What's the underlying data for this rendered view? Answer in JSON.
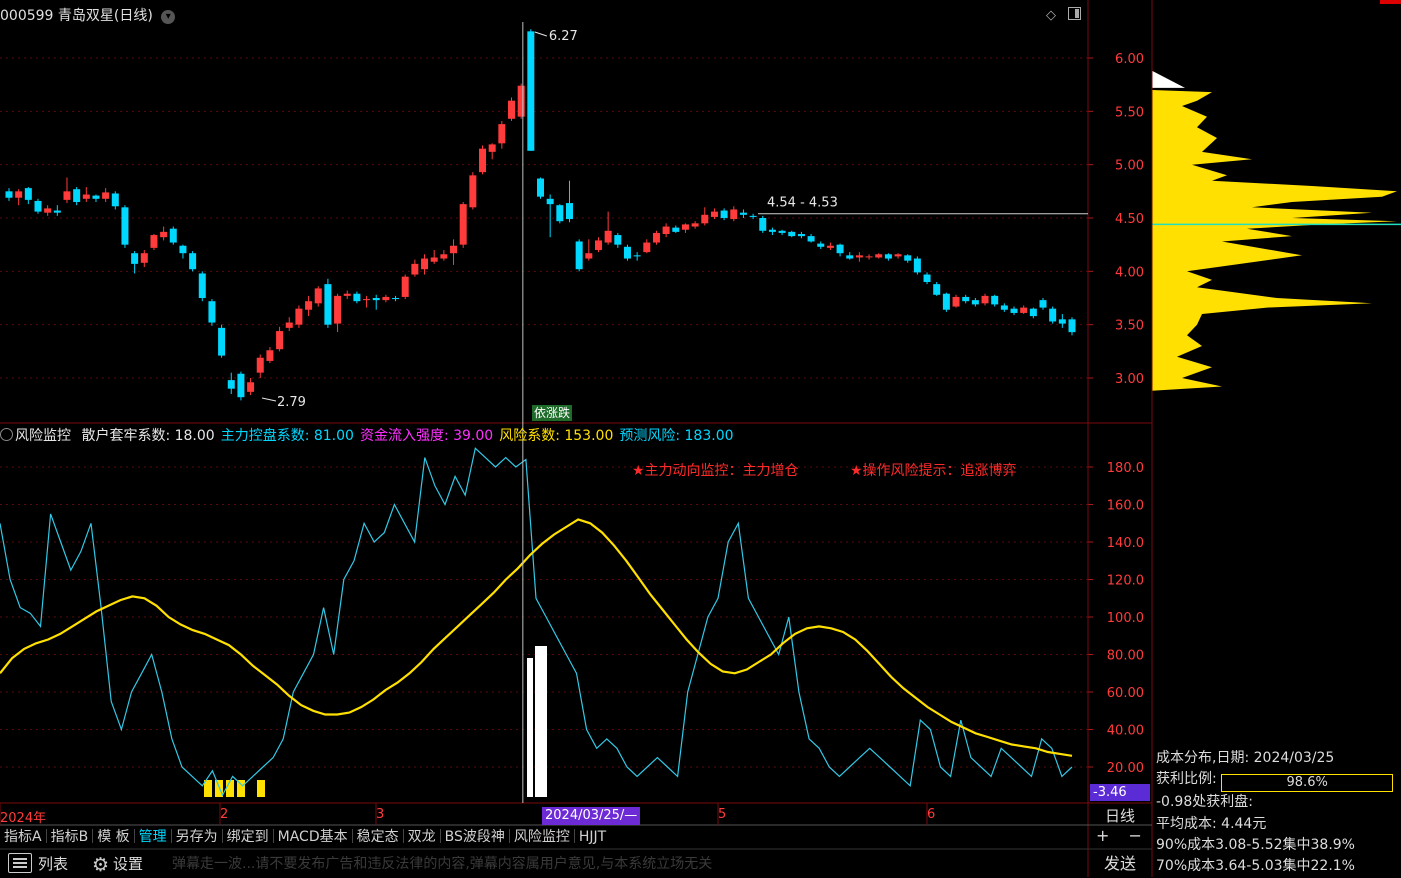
{
  "header": {
    "stock_code": "000599",
    "stock_name": "青岛双星",
    "period": "(日线)",
    "icon_chevron": "chevron-down-icon",
    "icon_diamond": "diamond-icon",
    "icon_panel": "panel-toggle-icon"
  },
  "price_axis": {
    "labels": [
      "6.00",
      "5.50",
      "5.00",
      "4.50",
      "4.00",
      "3.50",
      "3.00"
    ],
    "values": [
      6.0,
      5.5,
      5.0,
      4.5,
      4.0,
      3.5,
      3.0
    ],
    "color": "#ff3b3b"
  },
  "annotations": {
    "high_label": "6.27",
    "low_label": "2.79",
    "range_label": "4.54 - 4.53",
    "signal_tag": "依涨跌"
  },
  "indicator": {
    "name": "风险监控",
    "params": [
      {
        "label": "散户套牢系数:",
        "value": "18.00",
        "color": "#e6e6e6"
      },
      {
        "label": "主力控盘系数:",
        "value": "81.00",
        "color": "#00d8ff"
      },
      {
        "label": "资金流入强度:",
        "value": "39.00",
        "color": "#ff30ff"
      },
      {
        "label": "风险系数:",
        "value": "153.00",
        "color": "#ffe000"
      },
      {
        "label": "预测风险:",
        "value": "183.00",
        "color": "#00d8ff"
      }
    ],
    "hint1": "★主力动向监控：主力增仓",
    "hint2": "★操作风险提示：追涨博弈",
    "axis_labels": [
      "180.0",
      "160.0",
      "140.0",
      "120.0",
      "100.0",
      "80.00",
      "60.00",
      "40.00",
      "20.00"
    ],
    "axis_values": [
      180,
      160,
      140,
      120,
      100,
      80,
      60,
      40,
      20
    ],
    "current_value": "-3.46"
  },
  "time_axis": {
    "labels": [
      {
        "text": "2024年",
        "pos": 0
      },
      {
        "text": "2",
        "pos": 220
      },
      {
        "text": "3",
        "pos": 376
      },
      {
        "text": "5",
        "pos": 718
      },
      {
        "text": "6",
        "pos": 927
      }
    ],
    "cursor_date": "2024/03/25/—"
  },
  "period_label": "日线",
  "tabs": [
    "指标A",
    "指标B",
    "模 板",
    "管理",
    "另存为",
    "绑定到",
    "MACD基本",
    "稳定态",
    "双龙",
    "BS波段神",
    "风险监控",
    "HJJT"
  ],
  "active_tab": "管理",
  "zoom": {
    "plus": "+",
    "minus": "−"
  },
  "bottom": {
    "list_label": "列表",
    "settings_label": "设置",
    "marquee": "弹幕走一波...请不要发布广告和违反法律的内容,弹幕内容属用户意见,与本系统立场无关",
    "send_label": "发送"
  },
  "cost_distribution": {
    "date_label": "成本分布,日期:",
    "date": "2024/03/25",
    "profit_label": "获利比例:",
    "profit_ratio": "98.6%",
    "profit_fraction": 0.986,
    "line3": "-0.98处获利盘:",
    "avg_cost": "平均成本: 4.44元",
    "cost90": "90%成本3.08-5.52集中38.9%",
    "cost70": "70%成本3.64-5.03集中22.1%"
  },
  "chart_data": {
    "type": "candlestick+line",
    "candles": [
      {
        "o": 4.75,
        "c": 4.69,
        "h": 4.78,
        "l": 4.66
      },
      {
        "o": 4.69,
        "c": 4.75,
        "h": 4.77,
        "l": 4.62
      },
      {
        "o": 4.78,
        "c": 4.67,
        "h": 4.79,
        "l": 4.63
      },
      {
        "o": 4.66,
        "c": 4.56,
        "h": 4.68,
        "l": 4.54
      },
      {
        "o": 4.55,
        "c": 4.59,
        "h": 4.62,
        "l": 4.52
      },
      {
        "o": 4.57,
        "c": 4.55,
        "h": 4.62,
        "l": 4.52
      },
      {
        "o": 4.67,
        "c": 4.75,
        "h": 4.88,
        "l": 4.64
      },
      {
        "o": 4.77,
        "c": 4.65,
        "h": 4.79,
        "l": 4.62
      },
      {
        "o": 4.68,
        "c": 4.72,
        "h": 4.79,
        "l": 4.65
      },
      {
        "o": 4.71,
        "c": 4.68,
        "h": 4.72,
        "l": 4.65
      },
      {
        "o": 4.68,
        "c": 4.74,
        "h": 4.78,
        "l": 4.65
      },
      {
        "o": 4.73,
        "c": 4.61,
        "h": 4.75,
        "l": 4.58
      },
      {
        "o": 4.6,
        "c": 4.25,
        "h": 4.62,
        "l": 4.22
      },
      {
        "o": 4.17,
        "c": 4.07,
        "h": 4.19,
        "l": 3.98
      },
      {
        "o": 4.08,
        "c": 4.17,
        "h": 4.2,
        "l": 4.04
      },
      {
        "o": 4.22,
        "c": 4.34,
        "h": 4.35,
        "l": 4.2
      },
      {
        "o": 4.32,
        "c": 4.37,
        "h": 4.42,
        "l": 4.29
      },
      {
        "o": 4.4,
        "c": 4.27,
        "h": 4.42,
        "l": 4.25
      },
      {
        "o": 4.24,
        "c": 4.17,
        "h": 4.25,
        "l": 4.12
      },
      {
        "o": 4.17,
        "c": 4.02,
        "h": 4.19,
        "l": 4.0
      },
      {
        "o": 3.98,
        "c": 3.75,
        "h": 4.0,
        "l": 3.72
      },
      {
        "o": 3.72,
        "c": 3.52,
        "h": 3.74,
        "l": 3.49
      },
      {
        "o": 3.47,
        "c": 3.21,
        "h": 3.5,
        "l": 3.19
      },
      {
        "o": 2.98,
        "c": 2.9,
        "h": 3.05,
        "l": 2.85
      },
      {
        "o": 3.04,
        "c": 2.82,
        "h": 3.06,
        "l": 2.79
      },
      {
        "o": 2.87,
        "c": 2.96,
        "h": 3.0,
        "l": 2.84
      },
      {
        "o": 3.05,
        "c": 3.19,
        "h": 3.22,
        "l": 3.0
      },
      {
        "o": 3.16,
        "c": 3.26,
        "h": 3.29,
        "l": 3.14
      },
      {
        "o": 3.27,
        "c": 3.44,
        "h": 3.48,
        "l": 3.25
      },
      {
        "o": 3.47,
        "c": 3.52,
        "h": 3.57,
        "l": 3.44
      },
      {
        "o": 3.5,
        "c": 3.65,
        "h": 3.68,
        "l": 3.47
      },
      {
        "o": 3.64,
        "c": 3.72,
        "h": 3.77,
        "l": 3.58
      },
      {
        "o": 3.7,
        "c": 3.84,
        "h": 3.86,
        "l": 3.67
      },
      {
        "o": 3.88,
        "c": 3.5,
        "h": 3.93,
        "l": 3.47
      },
      {
        "o": 3.51,
        "c": 3.77,
        "h": 3.79,
        "l": 3.43
      },
      {
        "o": 3.77,
        "c": 3.79,
        "h": 3.82,
        "l": 3.74
      },
      {
        "o": 3.79,
        "c": 3.72,
        "h": 3.81,
        "l": 3.7
      },
      {
        "o": 3.73,
        "c": 3.74,
        "h": 3.77,
        "l": 3.66
      },
      {
        "o": 3.75,
        "c": 3.73,
        "h": 3.78,
        "l": 3.64
      },
      {
        "o": 3.73,
        "c": 3.76,
        "h": 3.78,
        "l": 3.71
      },
      {
        "o": 3.75,
        "c": 3.74,
        "h": 3.77,
        "l": 3.72
      },
      {
        "o": 3.76,
        "c": 3.95,
        "h": 3.97,
        "l": 3.74
      },
      {
        "o": 3.97,
        "c": 4.07,
        "h": 4.11,
        "l": 3.95
      },
      {
        "o": 4.02,
        "c": 4.12,
        "h": 4.16,
        "l": 3.97
      },
      {
        "o": 4.09,
        "c": 4.13,
        "h": 4.2,
        "l": 4.07
      },
      {
        "o": 4.12,
        "c": 4.16,
        "h": 4.2,
        "l": 4.1
      },
      {
        "o": 4.17,
        "c": 4.24,
        "h": 4.3,
        "l": 4.06
      },
      {
        "o": 4.25,
        "c": 4.63,
        "h": 4.65,
        "l": 4.22
      },
      {
        "o": 4.6,
        "c": 4.9,
        "h": 4.93,
        "l": 4.58
      },
      {
        "o": 4.93,
        "c": 5.15,
        "h": 5.18,
        "l": 4.91
      },
      {
        "o": 5.12,
        "c": 5.19,
        "h": 5.2,
        "l": 5.05
      },
      {
        "o": 5.2,
        "c": 5.38,
        "h": 5.41,
        "l": 5.15
      },
      {
        "o": 5.43,
        "c": 5.6,
        "h": 5.63,
        "l": 5.41
      },
      {
        "o": 5.45,
        "c": 5.74,
        "h": 5.76,
        "l": 5.43
      },
      {
        "o": 6.25,
        "c": 5.13,
        "h": 6.27,
        "l": 5.13
      },
      {
        "o": 4.87,
        "c": 4.7,
        "h": 4.88,
        "l": 4.68
      },
      {
        "o": 4.68,
        "c": 4.63,
        "h": 4.72,
        "l": 4.32
      },
      {
        "o": 4.62,
        "c": 4.47,
        "h": 4.63,
        "l": 4.45
      },
      {
        "o": 4.64,
        "c": 4.49,
        "h": 4.85,
        "l": 4.46
      },
      {
        "o": 4.28,
        "c": 4.02,
        "h": 4.3,
        "l": 4.0
      },
      {
        "o": 4.12,
        "c": 4.17,
        "h": 4.3,
        "l": 4.1
      },
      {
        "o": 4.2,
        "c": 4.29,
        "h": 4.32,
        "l": 4.18
      },
      {
        "o": 4.27,
        "c": 4.38,
        "h": 4.56,
        "l": 4.25
      },
      {
        "o": 4.34,
        "c": 4.25,
        "h": 4.36,
        "l": 4.22
      },
      {
        "o": 4.23,
        "c": 4.12,
        "h": 4.25,
        "l": 4.1
      },
      {
        "o": 4.15,
        "c": 4.14,
        "h": 4.18,
        "l": 4.1
      },
      {
        "o": 4.18,
        "c": 4.27,
        "h": 4.3,
        "l": 4.17
      },
      {
        "o": 4.27,
        "c": 4.36,
        "h": 4.38,
        "l": 4.25
      },
      {
        "o": 4.35,
        "c": 4.42,
        "h": 4.45,
        "l": 4.32
      },
      {
        "o": 4.41,
        "c": 4.37,
        "h": 4.43,
        "l": 4.36
      },
      {
        "o": 4.39,
        "c": 4.44,
        "h": 4.45,
        "l": 4.36
      },
      {
        "o": 4.42,
        "c": 4.45,
        "h": 4.47,
        "l": 4.4
      },
      {
        "o": 4.45,
        "c": 4.53,
        "h": 4.6,
        "l": 4.43
      },
      {
        "o": 4.51,
        "c": 4.56,
        "h": 4.59,
        "l": 4.49
      },
      {
        "o": 4.57,
        "c": 4.5,
        "h": 4.59,
        "l": 4.48
      },
      {
        "o": 4.49,
        "c": 4.58,
        "h": 4.61,
        "l": 4.47
      },
      {
        "o": 4.55,
        "c": 4.53,
        "h": 4.58,
        "l": 4.5
      },
      {
        "o": 4.52,
        "c": 4.51,
        "h": 4.54,
        "l": 4.49
      },
      {
        "o": 4.5,
        "c": 4.38,
        "h": 4.52,
        "l": 4.36
      },
      {
        "o": 4.39,
        "c": 4.37,
        "h": 4.41,
        "l": 4.34
      },
      {
        "o": 4.38,
        "c": 4.36,
        "h": 4.39,
        "l": 4.34
      },
      {
        "o": 4.37,
        "c": 4.33,
        "h": 4.38,
        "l": 4.32
      },
      {
        "o": 4.35,
        "c": 4.33,
        "h": 4.37,
        "l": 4.31
      },
      {
        "o": 4.33,
        "c": 4.28,
        "h": 4.35,
        "l": 4.27
      },
      {
        "o": 4.26,
        "c": 4.23,
        "h": 4.28,
        "l": 4.21
      },
      {
        "o": 4.22,
        "c": 4.24,
        "h": 4.27,
        "l": 4.2
      },
      {
        "o": 4.25,
        "c": 4.17,
        "h": 4.26,
        "l": 4.14
      },
      {
        "o": 4.15,
        "c": 4.12,
        "h": 4.18,
        "l": 4.11
      },
      {
        "o": 4.13,
        "c": 4.15,
        "h": 4.18,
        "l": 4.09
      },
      {
        "o": 4.14,
        "c": 4.14,
        "h": 4.16,
        "l": 4.11
      },
      {
        "o": 4.13,
        "c": 4.16,
        "h": 4.17,
        "l": 4.12
      },
      {
        "o": 4.16,
        "c": 4.12,
        "h": 4.17,
        "l": 4.1
      },
      {
        "o": 4.14,
        "c": 4.16,
        "h": 4.17,
        "l": 4.12
      },
      {
        "o": 4.15,
        "c": 4.1,
        "h": 4.16,
        "l": 4.08
      },
      {
        "o": 4.12,
        "c": 3.99,
        "h": 4.14,
        "l": 3.97
      },
      {
        "o": 3.97,
        "c": 3.9,
        "h": 3.99,
        "l": 3.88
      },
      {
        "o": 3.88,
        "c": 3.78,
        "h": 3.9,
        "l": 3.77
      },
      {
        "o": 3.79,
        "c": 3.64,
        "h": 3.8,
        "l": 3.62
      },
      {
        "o": 3.67,
        "c": 3.76,
        "h": 3.78,
        "l": 3.66
      },
      {
        "o": 3.76,
        "c": 3.72,
        "h": 3.78,
        "l": 3.7
      },
      {
        "o": 3.73,
        "c": 3.69,
        "h": 3.75,
        "l": 3.67
      },
      {
        "o": 3.7,
        "c": 3.77,
        "h": 3.79,
        "l": 3.68
      },
      {
        "o": 3.77,
        "c": 3.69,
        "h": 3.78,
        "l": 3.67
      },
      {
        "o": 3.68,
        "c": 3.64,
        "h": 3.7,
        "l": 3.62
      },
      {
        "o": 3.65,
        "c": 3.61,
        "h": 3.67,
        "l": 3.59
      },
      {
        "o": 3.61,
        "c": 3.66,
        "h": 3.68,
        "l": 3.6
      },
      {
        "o": 3.65,
        "c": 3.58,
        "h": 3.66,
        "l": 3.56
      },
      {
        "o": 3.73,
        "c": 3.66,
        "h": 3.75,
        "l": 3.64
      },
      {
        "o": 3.65,
        "c": 3.53,
        "h": 3.67,
        "l": 3.51
      },
      {
        "o": 3.55,
        "c": 3.51,
        "h": 3.6,
        "l": 3.47
      },
      {
        "o": 3.55,
        "c": 3.43,
        "h": 3.57,
        "l": 3.4
      }
    ],
    "indicator_cyan": [
      150,
      120,
      105,
      102,
      95,
      155,
      140,
      125,
      135,
      150,
      105,
      55,
      40,
      60,
      70,
      80,
      60,
      35,
      20,
      15,
      10,
      18,
      5,
      15,
      10,
      15,
      20,
      25,
      35,
      60,
      70,
      80,
      105,
      80,
      120,
      130,
      150,
      140,
      145,
      160,
      150,
      140,
      185,
      170,
      160,
      175,
      165,
      190,
      185,
      180,
      185,
      180,
      184,
      110,
      100,
      90,
      80,
      70,
      40,
      30,
      35,
      30,
      20,
      15,
      20,
      25,
      20,
      15,
      60,
      80,
      100,
      110,
      140,
      150,
      110,
      100,
      90,
      80,
      100,
      60,
      35,
      30,
      20,
      15,
      20,
      25,
      30,
      25,
      20,
      15,
      10,
      45,
      40,
      20,
      15,
      45,
      25,
      20,
      15,
      30,
      25,
      20,
      15,
      35,
      30,
      15,
      20
    ],
    "indicator_yellow": [
      70,
      78,
      83,
      86,
      88,
      91,
      95,
      99,
      103,
      106,
      109,
      111,
      110,
      106,
      100,
      96,
      93,
      91,
      88,
      85,
      80,
      74,
      69,
      64,
      58,
      53,
      50,
      48,
      48,
      49,
      52,
      56,
      61,
      65,
      70,
      76,
      83,
      89,
      95,
      101,
      107,
      113,
      120,
      126,
      133,
      139,
      144,
      148,
      152,
      150,
      145,
      138,
      130,
      121,
      112,
      104,
      96,
      88,
      81,
      75,
      71,
      70,
      72,
      76,
      80,
      86,
      91,
      94,
      95,
      94,
      92,
      88,
      82,
      75,
      68,
      62,
      57,
      52,
      48,
      44,
      41,
      38,
      36,
      34,
      32,
      31,
      30,
      28,
      27,
      26
    ],
    "indicator_bars": {
      "yellow_bars_at": [
        0,
        1,
        2,
        3,
        5
      ],
      "white_bars_at": [
        0,
        1,
        2
      ]
    },
    "indicator_ylim": [
      0,
      200
    ],
    "price_ylim": [
      2.6,
      6.45
    ]
  }
}
